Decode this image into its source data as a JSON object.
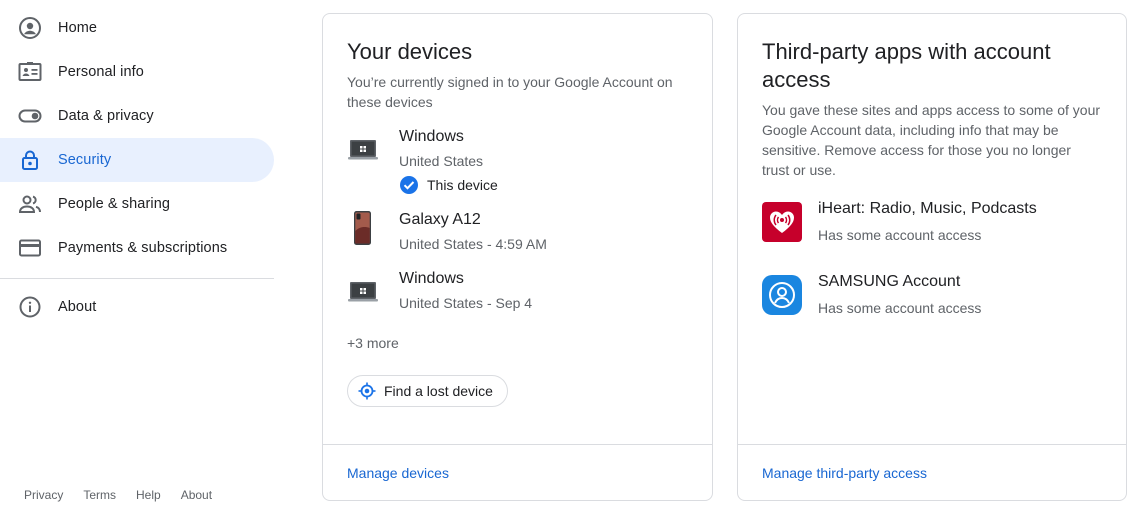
{
  "sidebar": {
    "items": [
      {
        "label": "Home",
        "icon": "account-circle-icon"
      },
      {
        "label": "Personal info",
        "icon": "badge-icon"
      },
      {
        "label": "Data & privacy",
        "icon": "toggle-icon"
      },
      {
        "label": "Security",
        "icon": "lock-icon",
        "active": true
      },
      {
        "label": "People & sharing",
        "icon": "people-icon"
      },
      {
        "label": "Payments & subscriptions",
        "icon": "credit-card-icon"
      }
    ],
    "about": {
      "label": "About",
      "icon": "info-icon"
    }
  },
  "footer": {
    "links": [
      "Privacy",
      "Terms",
      "Help",
      "About"
    ]
  },
  "devices_card": {
    "title": "Your devices",
    "description": "You’re currently signed in to your Google Account on these devices",
    "devices": [
      {
        "name": "Windows",
        "meta": "United States",
        "this_device": "This device",
        "icon": "laptop-icon"
      },
      {
        "name": "Galaxy A12",
        "meta": "United States - 4:59 AM",
        "icon": "phone-icon"
      },
      {
        "name": "Windows",
        "meta": "United States - Sep 4",
        "icon": "laptop-icon"
      }
    ],
    "more": "+3 more",
    "find_button": "Find a lost device",
    "manage_link": "Manage devices"
  },
  "apps_card": {
    "title": "Third-party apps with account access",
    "description": "You gave these sites and apps access to some of your Google Account data, including info that may be sensitive. Remove access for those you no longer trust or use.",
    "apps": [
      {
        "name": "iHeart: Radio, Music, Podcasts",
        "meta": "Has some account access",
        "color": "#c6002b"
      },
      {
        "name": "SAMSUNG Account",
        "meta": "Has some account access",
        "color": "#1a86e0"
      }
    ],
    "manage_link": "Manage third-party access"
  },
  "colors": {
    "accent": "#1967d2",
    "active_bg": "#e8f0fe",
    "border": "#dadce0"
  }
}
